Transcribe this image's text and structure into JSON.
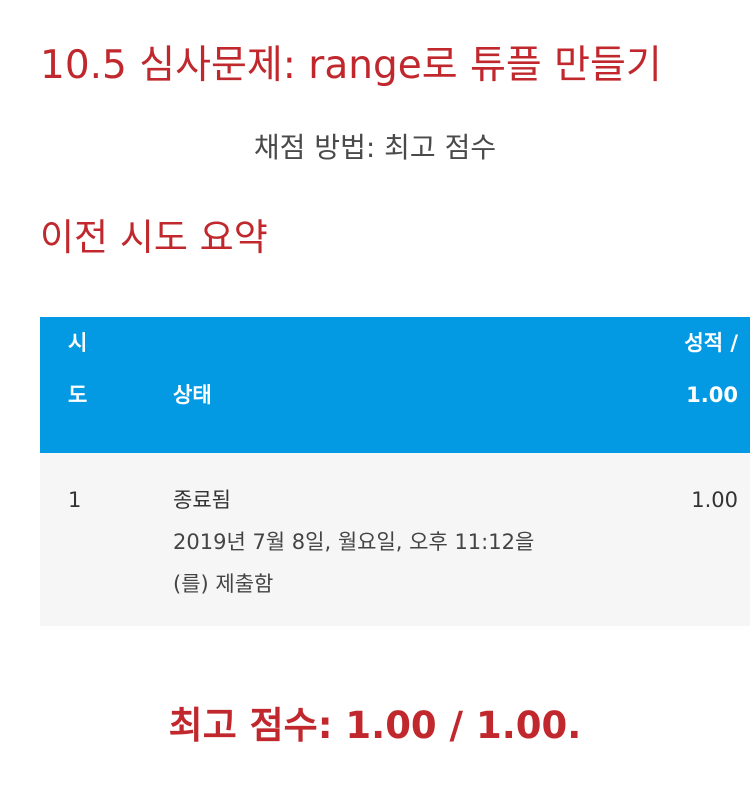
{
  "quiz": {
    "title": "10.5 심사문제: range로 튜플 만들기",
    "grading_method": "채점 방법: 최고 점수"
  },
  "summary": {
    "heading": "이전 시도 요약",
    "table": {
      "headers": {
        "attempt_line1": "시",
        "attempt_line2": "도",
        "state": "상태",
        "grade_line1": "성적 /",
        "grade_line2": "1.00"
      },
      "rows": [
        {
          "attempt": "1",
          "state": "종료됨",
          "submitted_line1": "2019년 7월 8일, 월요일, 오후 11:12을",
          "submitted_line2": "(를) 제출함",
          "grade": "1.00"
        }
      ]
    }
  },
  "final": {
    "text": "최고 점수: 1.00 / 1.00."
  },
  "colors": {
    "heading_red": "#c0282d",
    "table_header_blue": "#039ae3",
    "row_background": "#f6f6f6"
  }
}
